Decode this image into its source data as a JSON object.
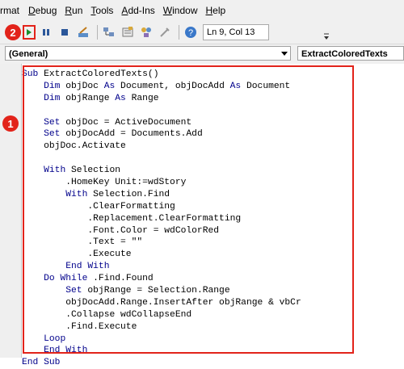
{
  "menubar": {
    "items": [
      {
        "label": "rmat",
        "mnemonic": ""
      },
      {
        "label": "Debug",
        "mnemonic": "D"
      },
      {
        "label": "Run",
        "mnemonic": "R"
      },
      {
        "label": "Tools",
        "mnemonic": "T"
      },
      {
        "label": "Add-Ins",
        "mnemonic": "A"
      },
      {
        "label": "Window",
        "mnemonic": "W"
      },
      {
        "label": "Help",
        "mnemonic": "H"
      }
    ]
  },
  "toolbar": {
    "position_text": "Ln 9, Col 13",
    "badge_run": "2"
  },
  "dropdowns": {
    "object": "(General)",
    "procedure": "ExtractColoredTexts"
  },
  "editor": {
    "badge_code": "1",
    "keywords": [
      "Sub",
      "End Sub",
      "Dim",
      "As",
      "Set",
      "With",
      "End With",
      "Do While",
      "Loop"
    ],
    "lines": [
      "Sub ExtractColoredTexts()",
      "    Dim objDoc As Document, objDocAdd As Document",
      "    Dim objRange As Range",
      "",
      "    Set objDoc = ActiveDocument",
      "    Set objDocAdd = Documents.Add",
      "    objDoc.Activate",
      "",
      "    With Selection",
      "        .HomeKey Unit:=wdStory",
      "        With Selection.Find",
      "            .ClearFormatting",
      "            .Replacement.ClearFormatting",
      "            .Font.Color = wdColorRed",
      "            .Text = \"\"",
      "            .Execute",
      "        End With",
      "    Do While .Find.Found",
      "        Set objRange = Selection.Range",
      "        objDocAdd.Range.InsertAfter objRange & vbCr",
      "        .Collapse wdCollapseEnd",
      "        .Find.Execute",
      "    Loop",
      "    End With",
      "End Sub"
    ]
  },
  "colors": {
    "keyword": "#00008b",
    "annotation_red": "#e2231a"
  }
}
